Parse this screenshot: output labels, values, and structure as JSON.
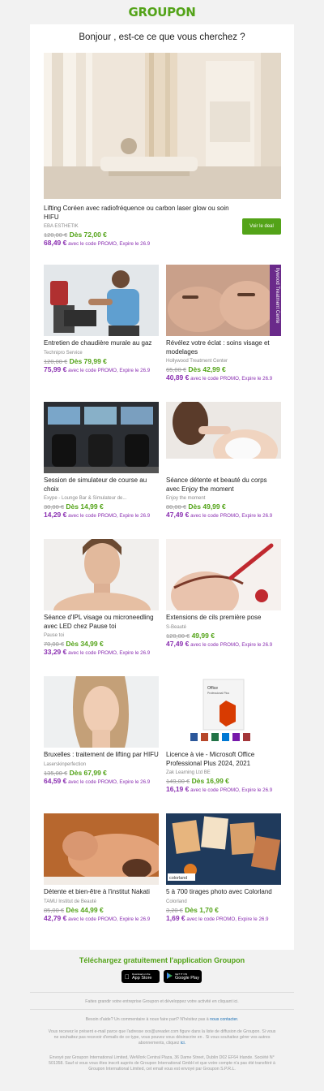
{
  "brand": {
    "logo": "GROUPON"
  },
  "greeting": "Bonjour , est-ce ce que vous cherchez ?",
  "hero": {
    "title": "Lifting Coréen avec radiofréquence ou carbon laser glow ou soin HIFU",
    "merchant": "EBA ESTHETIK",
    "old_price": "120,00 €",
    "new_price": "Dès 72,00 €",
    "promo_price": "68,49 €",
    "promo_text": "avec le code PROMO, Expire le 26.9",
    "cta_label": "Voir le deal"
  },
  "deals": [
    {
      "title": "Entretien de chaudière murale au gaz",
      "merchant": "Technipro Service",
      "old_price": "120,00 €",
      "new_price": "Dès 79,99 €",
      "promo_price": "75,99 €",
      "promo_text": "avec le code PROMO, Expire le 26.9"
    },
    {
      "title": "Révélez votre éclat : soins visage et modelages",
      "merchant": "Hollywood Treatment Center",
      "old_price": "65,00 €",
      "new_price": "Dès 42,99 €",
      "promo_price": "40,89 €",
      "promo_text": "avec le code PROMO, Expire le 26.9",
      "image_overlay": "llywood Treatment Cente"
    },
    {
      "title": "Session de simulateur de course au choix",
      "merchant": "Exype - Lounge Bar & Simulateur de...",
      "old_price": "30,00 €",
      "new_price": "Dès 14,99 €",
      "promo_price": "14,29 €",
      "promo_text": "avec le code PROMO, Expire le 26.9"
    },
    {
      "title": "Séance détente et beauté du corps avec Enjoy the moment",
      "merchant": "Enjoy the moment",
      "old_price": "80,00 €",
      "new_price": "Dès 49,99 €",
      "promo_price": "47,49 €",
      "promo_text": "avec le code PROMO, Expire le 26.9"
    },
    {
      "title": "Séance d'IPL visage ou microneedling avec LED chez Pause toi",
      "merchant": "Pause toi",
      "old_price": "70,00 €",
      "new_price": "Dès 34,99 €",
      "promo_price": "33,29 €",
      "promo_text": "avec le code PROMO, Expire le 26.9"
    },
    {
      "title": "Extensions de cils première pose",
      "merchant": "S-Beauté",
      "old_price": "120,00 €",
      "new_price": "49,99 €",
      "promo_price": "47,49 €",
      "promo_text": "avec le code PROMO, Expire le 26.9"
    },
    {
      "title": "Bruxelles : traitement de lifting par HIFU",
      "merchant": "Laserskinperfection",
      "old_price": "135,00 €",
      "new_price": "Dès 67,99 €",
      "promo_price": "64,59 €",
      "promo_text": "avec le code PROMO, Expire le 26.9"
    },
    {
      "title": "Licence à vie - Microsoft Office Professional Plus 2024, 2021",
      "merchant": "Zak Learning Ltd BE",
      "old_price": "149,00 €",
      "new_price": "Dès 16,99 €",
      "promo_price": "16,19 €",
      "promo_text": "avec le code PROMO, Expire le 26.9",
      "image_box_line1": "Office",
      "image_box_line2": "Professional Plus"
    },
    {
      "title": "Détente et bien-être à l'institut Nakati",
      "merchant": "TAMU Institut de Beauté",
      "old_price": "85,00 €",
      "new_price": "Dès 44,99 €",
      "promo_price": "42,79 €",
      "promo_text": "avec le code PROMO, Expire le 26.9"
    },
    {
      "title": "5 à 700 tirages photo avec Colorland",
      "merchant": "Colorland",
      "old_price": "3,20 €",
      "new_price": "Dès 1,70 €",
      "promo_price": "1,69 €",
      "promo_text": "avec le code PROMO, Expire le 26.9",
      "image_logo": "colorland"
    }
  ],
  "app": {
    "title": "Téléchargez gratuitement l'application Groupon",
    "appstore_small": "Download on the",
    "appstore_big": "App Store",
    "googleplay_small": "GET IT ON",
    "googleplay_big": "Google Play"
  },
  "footer": {
    "grow": "Faites grandir votre entreprise Groupon et développez votre activité en cliquant ici.",
    "help_prefix": "Besoin d'aide? Un commentaire à nous faire part? N'hésitez pas à",
    "help_link": "nous contacter.",
    "notice_main": "Vous recevez le présent e-mail parce que l'adresse xxx@ureader.com figure dans la liste de diffusion de Groupon. Si vous ne souhaitez pas recevoir d'emails de ce type, vous pouvez vous désinscrire en . Si vous souhaitez gérer vos autres abonnements, cliquez",
    "notice_link": "ici.",
    "legal": "Envoyé par Groupon International Limited, WeWork Central Plaza, 36 Dame Street, Dublin D02 EF64 Irlande. Société N° 501358. Sauf si vous vous êtes inscrit auprès de Groupon International GmbH et que votre compte n'a pas été transféré à Groupon International Limited, cet email vous est envoyé par Groupon S.P.R.L."
  }
}
